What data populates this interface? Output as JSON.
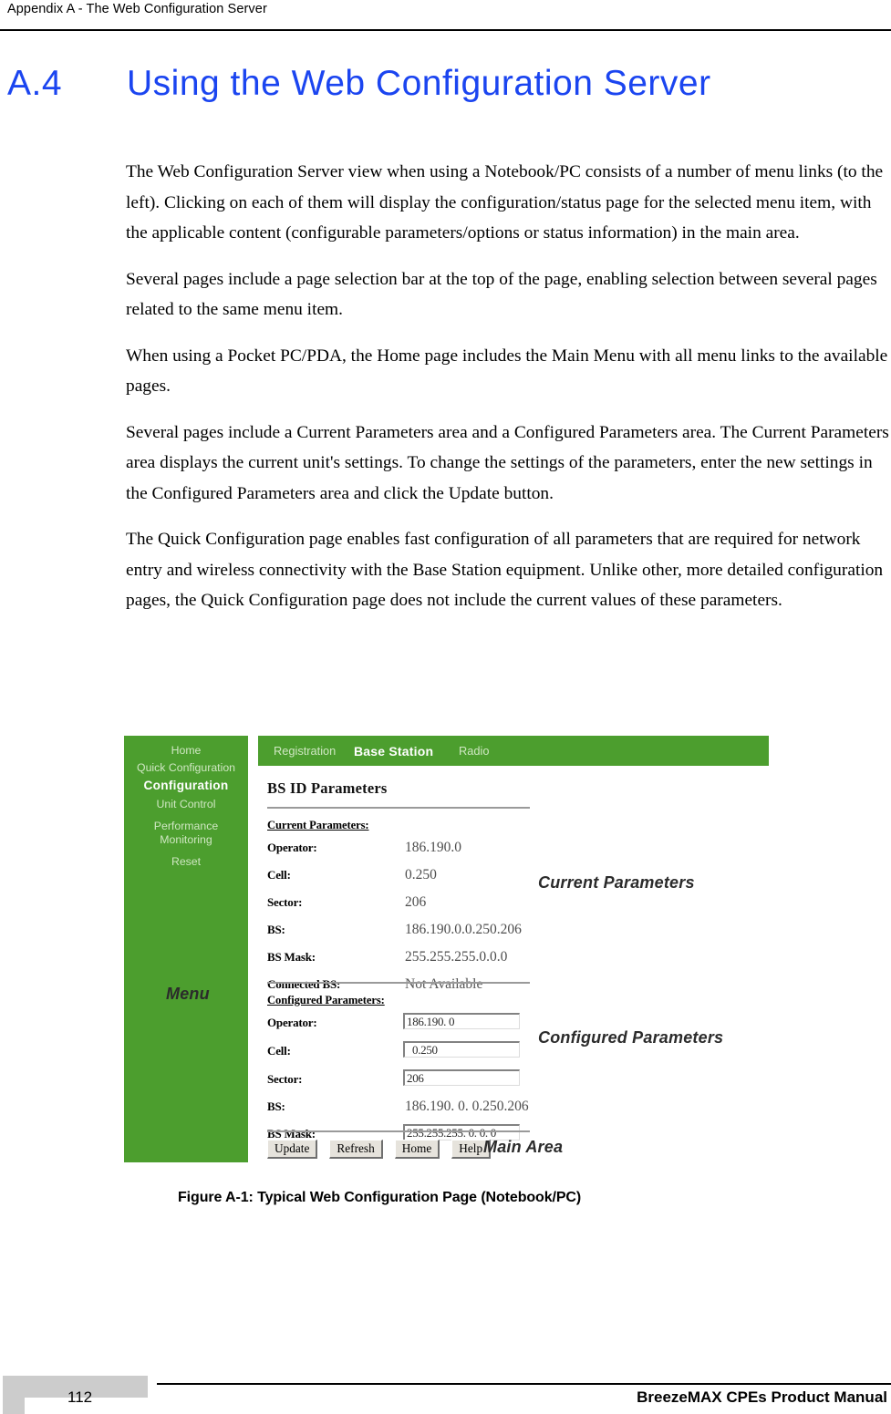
{
  "header": {
    "running_head": "Appendix A - The Web Configuration Server"
  },
  "section": {
    "number": "A.4",
    "title": "Using the Web Configuration Server",
    "color": "#1b45f0"
  },
  "body": {
    "paragraphs": [
      "The Web Configuration Server view when using a Notebook/PC consists of a number of menu links (to the left). Clicking on each of them will display the configuration/status page for the selected menu item, with the applicable content (configurable parameters/options or status information) in the main area.",
      "Several pages include a page selection bar at the top of the page, enabling selection between several pages related to the same menu item.",
      "When using a Pocket PC/PDA, the Home page includes the Main Menu with all menu links to the available pages.",
      "Several pages include a Current Parameters area and a Configured Parameters area. The Current Parameters area displays the current unit's settings. To change the settings of the parameters, enter the new settings in the Configured Parameters area and click the Update button.",
      "The Quick Configuration page enables fast configuration of all parameters that are required for network entry and wireless connectivity with the Base Station equipment. Unlike other, more detailed configuration pages, the Quick Configuration page does not include the current values of these parameters."
    ]
  },
  "figure": {
    "caption": "Figure A-1: Typical Web Configuration Page (Notebook/PC)",
    "accent_green": "#4c9e2e",
    "sidebar": {
      "items": [
        {
          "label": "Home",
          "selected": false
        },
        {
          "label": "Quick Configuration",
          "selected": false
        },
        {
          "label": "Configuration",
          "selected": true
        },
        {
          "label": "Unit Control",
          "selected": false
        },
        {
          "label": "Performance Monitoring",
          "selected": false
        },
        {
          "label": "Reset",
          "selected": false
        }
      ]
    },
    "topbar": {
      "tabs": [
        {
          "label": "Registration",
          "selected": false
        },
        {
          "label": "Base Station",
          "selected": true
        },
        {
          "label": "Radio",
          "selected": false
        }
      ]
    },
    "main": {
      "panel_title": "BS ID Parameters",
      "current_group_label": "Current Parameters:",
      "current_rows": [
        {
          "key": "Operator:",
          "value": "186.190.0"
        },
        {
          "key": "Cell:",
          "value": "0.250"
        },
        {
          "key": "Sector:",
          "value": "206"
        },
        {
          "key": "BS:",
          "value": "186.190.0.0.250.206"
        },
        {
          "key": "BS Mask:",
          "value": "255.255.255.0.0.0"
        },
        {
          "key": "Connected BS:",
          "value": "Not Available"
        }
      ],
      "configured_group_label": "Configured Parameters:",
      "configured_rows": [
        {
          "key": "Operator:",
          "value": "186.190. 0",
          "input": true
        },
        {
          "key": "Cell:",
          "value": "0.250",
          "input": true
        },
        {
          "key": "Sector:",
          "value": "206",
          "input": true
        },
        {
          "key": "BS:",
          "value": "186.190. 0. 0.250.206",
          "input": false
        },
        {
          "key": "BS Mask:",
          "value": "255.255.255. 0. 0. 0",
          "input": true
        }
      ],
      "buttons": [
        {
          "label": "Update"
        },
        {
          "label": "Refresh"
        },
        {
          "label": "Home"
        },
        {
          "label": "Help"
        }
      ]
    },
    "callouts": {
      "menu": "Menu",
      "current_parameters": "Current Parameters",
      "configured_parameters": "Configured Parameters",
      "main_area": "Main Area"
    }
  },
  "footer": {
    "page_number": "112",
    "manual_title": "BreezeMAX CPEs Product Manual"
  }
}
